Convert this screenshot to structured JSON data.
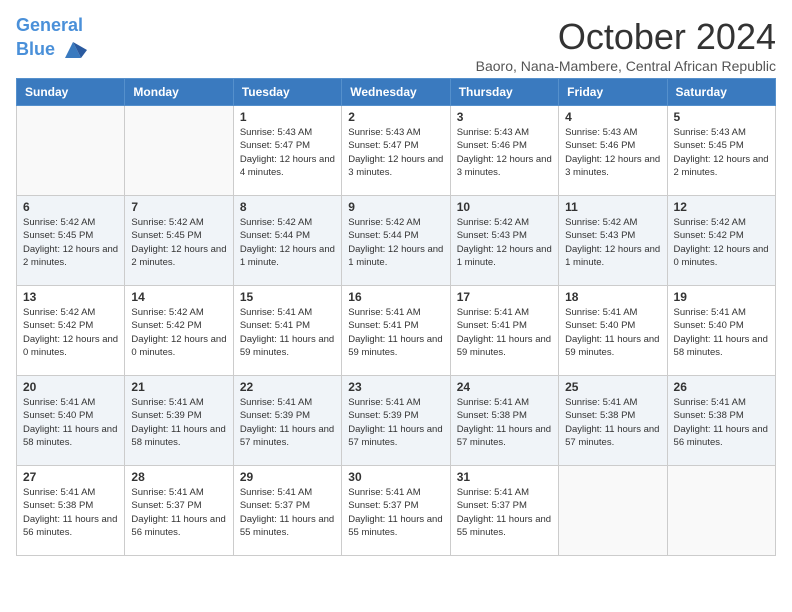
{
  "header": {
    "logo_line1": "General",
    "logo_line2": "Blue",
    "month_title": "October 2024",
    "subtitle": "Baoro, Nana-Mambere, Central African Republic"
  },
  "weekdays": [
    "Sunday",
    "Monday",
    "Tuesday",
    "Wednesday",
    "Thursday",
    "Friday",
    "Saturday"
  ],
  "weeks": [
    [
      {
        "day": "",
        "info": ""
      },
      {
        "day": "",
        "info": ""
      },
      {
        "day": "1",
        "info": "Sunrise: 5:43 AM\nSunset: 5:47 PM\nDaylight: 12 hours and 4 minutes."
      },
      {
        "day": "2",
        "info": "Sunrise: 5:43 AM\nSunset: 5:47 PM\nDaylight: 12 hours and 3 minutes."
      },
      {
        "day": "3",
        "info": "Sunrise: 5:43 AM\nSunset: 5:46 PM\nDaylight: 12 hours and 3 minutes."
      },
      {
        "day": "4",
        "info": "Sunrise: 5:43 AM\nSunset: 5:46 PM\nDaylight: 12 hours and 3 minutes."
      },
      {
        "day": "5",
        "info": "Sunrise: 5:43 AM\nSunset: 5:45 PM\nDaylight: 12 hours and 2 minutes."
      }
    ],
    [
      {
        "day": "6",
        "info": "Sunrise: 5:42 AM\nSunset: 5:45 PM\nDaylight: 12 hours and 2 minutes."
      },
      {
        "day": "7",
        "info": "Sunrise: 5:42 AM\nSunset: 5:45 PM\nDaylight: 12 hours and 2 minutes."
      },
      {
        "day": "8",
        "info": "Sunrise: 5:42 AM\nSunset: 5:44 PM\nDaylight: 12 hours and 1 minute."
      },
      {
        "day": "9",
        "info": "Sunrise: 5:42 AM\nSunset: 5:44 PM\nDaylight: 12 hours and 1 minute."
      },
      {
        "day": "10",
        "info": "Sunrise: 5:42 AM\nSunset: 5:43 PM\nDaylight: 12 hours and 1 minute."
      },
      {
        "day": "11",
        "info": "Sunrise: 5:42 AM\nSunset: 5:43 PM\nDaylight: 12 hours and 1 minute."
      },
      {
        "day": "12",
        "info": "Sunrise: 5:42 AM\nSunset: 5:42 PM\nDaylight: 12 hours and 0 minutes."
      }
    ],
    [
      {
        "day": "13",
        "info": "Sunrise: 5:42 AM\nSunset: 5:42 PM\nDaylight: 12 hours and 0 minutes."
      },
      {
        "day": "14",
        "info": "Sunrise: 5:42 AM\nSunset: 5:42 PM\nDaylight: 12 hours and 0 minutes."
      },
      {
        "day": "15",
        "info": "Sunrise: 5:41 AM\nSunset: 5:41 PM\nDaylight: 11 hours and 59 minutes."
      },
      {
        "day": "16",
        "info": "Sunrise: 5:41 AM\nSunset: 5:41 PM\nDaylight: 11 hours and 59 minutes."
      },
      {
        "day": "17",
        "info": "Sunrise: 5:41 AM\nSunset: 5:41 PM\nDaylight: 11 hours and 59 minutes."
      },
      {
        "day": "18",
        "info": "Sunrise: 5:41 AM\nSunset: 5:40 PM\nDaylight: 11 hours and 59 minutes."
      },
      {
        "day": "19",
        "info": "Sunrise: 5:41 AM\nSunset: 5:40 PM\nDaylight: 11 hours and 58 minutes."
      }
    ],
    [
      {
        "day": "20",
        "info": "Sunrise: 5:41 AM\nSunset: 5:40 PM\nDaylight: 11 hours and 58 minutes."
      },
      {
        "day": "21",
        "info": "Sunrise: 5:41 AM\nSunset: 5:39 PM\nDaylight: 11 hours and 58 minutes."
      },
      {
        "day": "22",
        "info": "Sunrise: 5:41 AM\nSunset: 5:39 PM\nDaylight: 11 hours and 57 minutes."
      },
      {
        "day": "23",
        "info": "Sunrise: 5:41 AM\nSunset: 5:39 PM\nDaylight: 11 hours and 57 minutes."
      },
      {
        "day": "24",
        "info": "Sunrise: 5:41 AM\nSunset: 5:38 PM\nDaylight: 11 hours and 57 minutes."
      },
      {
        "day": "25",
        "info": "Sunrise: 5:41 AM\nSunset: 5:38 PM\nDaylight: 11 hours and 57 minutes."
      },
      {
        "day": "26",
        "info": "Sunrise: 5:41 AM\nSunset: 5:38 PM\nDaylight: 11 hours and 56 minutes."
      }
    ],
    [
      {
        "day": "27",
        "info": "Sunrise: 5:41 AM\nSunset: 5:38 PM\nDaylight: 11 hours and 56 minutes."
      },
      {
        "day": "28",
        "info": "Sunrise: 5:41 AM\nSunset: 5:37 PM\nDaylight: 11 hours and 56 minutes."
      },
      {
        "day": "29",
        "info": "Sunrise: 5:41 AM\nSunset: 5:37 PM\nDaylight: 11 hours and 55 minutes."
      },
      {
        "day": "30",
        "info": "Sunrise: 5:41 AM\nSunset: 5:37 PM\nDaylight: 11 hours and 55 minutes."
      },
      {
        "day": "31",
        "info": "Sunrise: 5:41 AM\nSunset: 5:37 PM\nDaylight: 11 hours and 55 minutes."
      },
      {
        "day": "",
        "info": ""
      },
      {
        "day": "",
        "info": ""
      }
    ]
  ]
}
